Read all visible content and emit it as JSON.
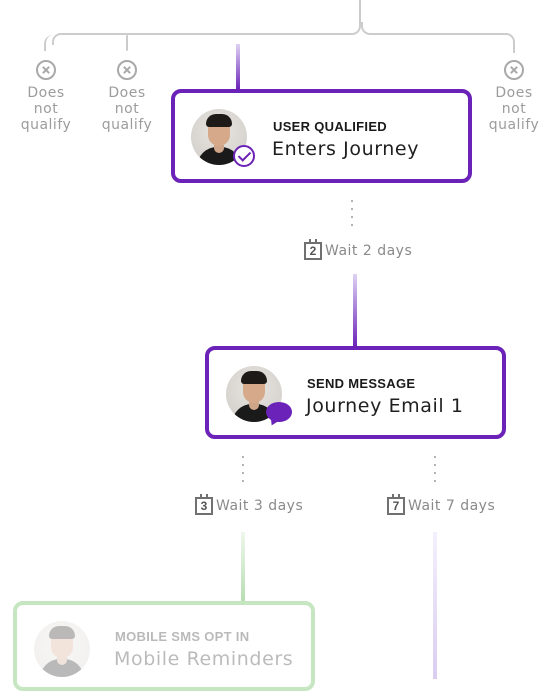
{
  "branches": {
    "label_line1": "Does",
    "label_line2": "not",
    "label_line3": "qualify"
  },
  "cards": {
    "qualified": {
      "title": "USER QUALIFIED",
      "subtitle": "Enters Journey"
    },
    "send_message": {
      "title": "SEND MESSAGE",
      "subtitle": "Journey Email 1"
    },
    "sms_opt_in": {
      "title": "MOBILE SMS OPT IN",
      "subtitle": "Mobile Reminders"
    }
  },
  "waits": {
    "wait1": {
      "number": "2",
      "label": "Wait 2 days"
    },
    "wait2": {
      "number": "3",
      "label": "Wait 3 days"
    },
    "wait3": {
      "number": "7",
      "label": "Wait 7 days"
    }
  },
  "colors": {
    "accent": "#6a22b8",
    "connector_gray": "#c8c8c8",
    "green": "#b5ddb0",
    "light_purple": "#d9cdf1"
  }
}
